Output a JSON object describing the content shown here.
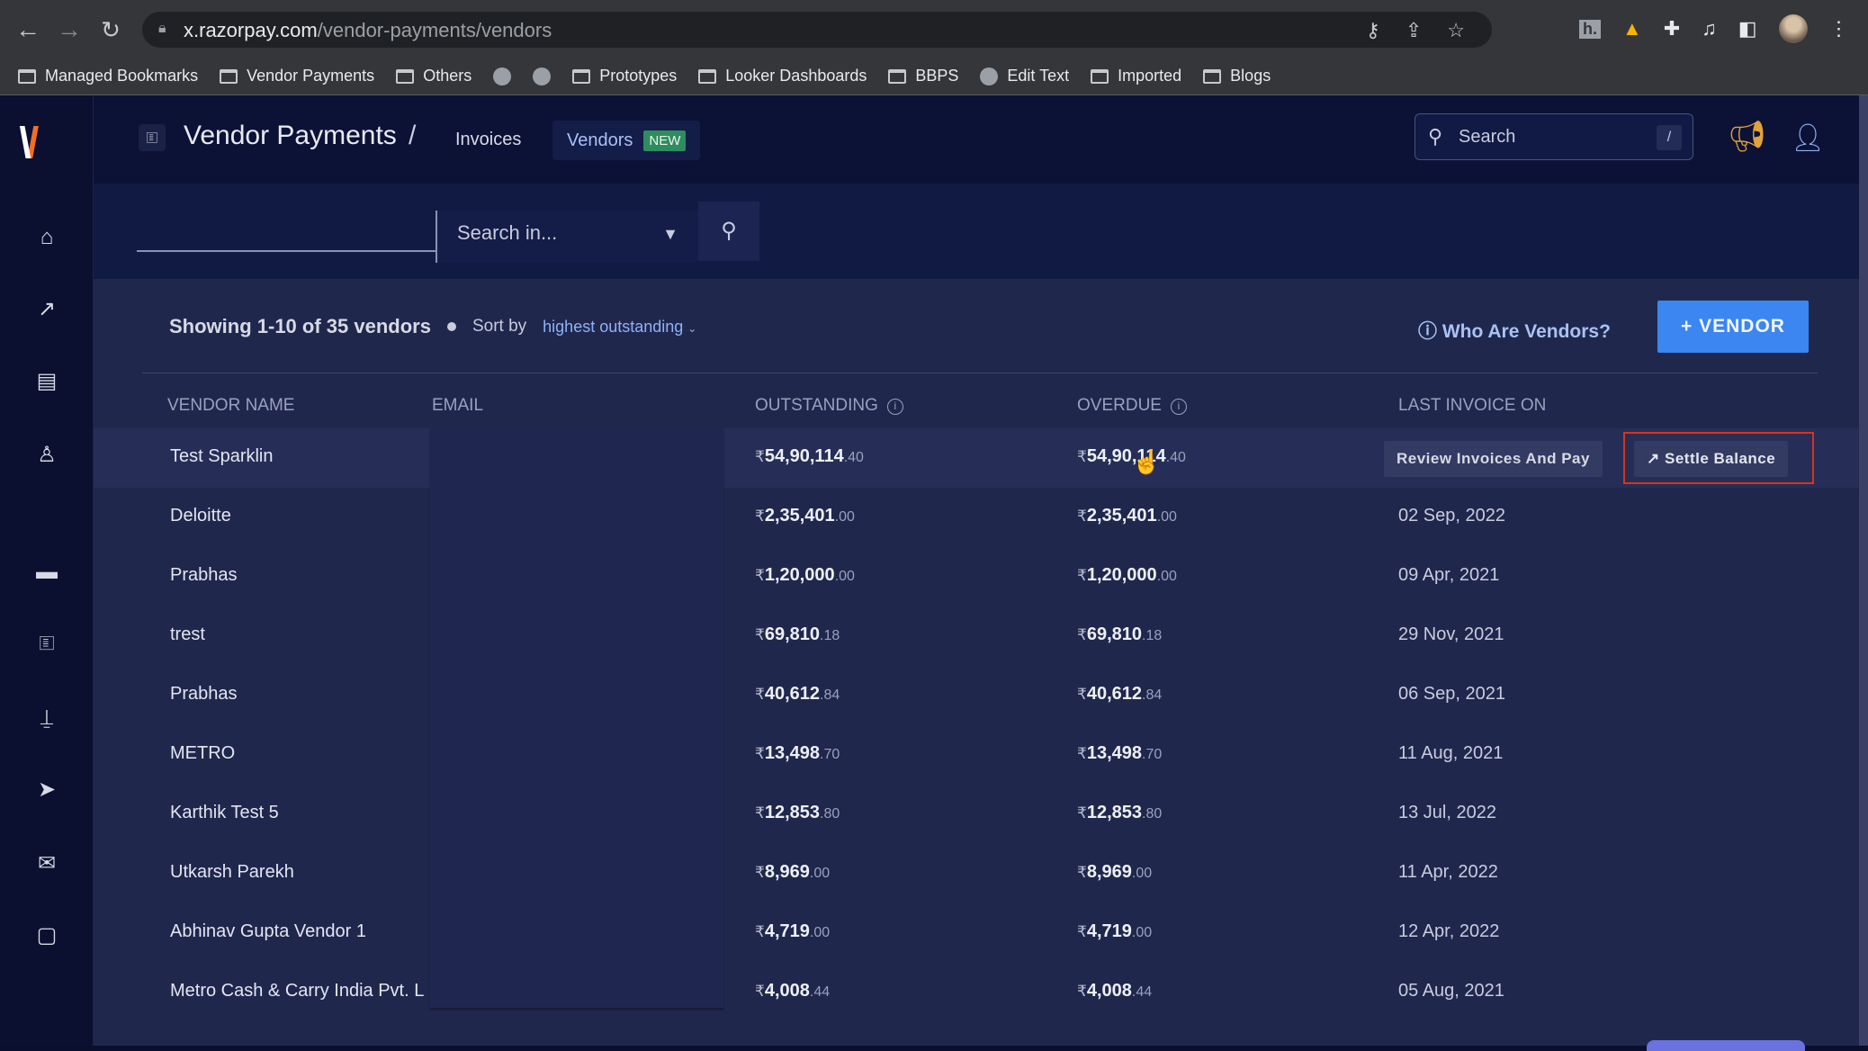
{
  "browser": {
    "url_host": "x.razorpay.com",
    "url_path": "/vendor-payments/vendors",
    "bookmarks": [
      {
        "label": "Managed Bookmarks",
        "type": "folder"
      },
      {
        "label": "Vendor Payments",
        "type": "folder"
      },
      {
        "label": "Others",
        "type": "folder"
      },
      {
        "label": "",
        "type": "globe"
      },
      {
        "label": "",
        "type": "globe"
      },
      {
        "label": "Prototypes",
        "type": "folder"
      },
      {
        "label": "Looker Dashboards",
        "type": "folder"
      },
      {
        "label": "BBPS",
        "type": "folder"
      },
      {
        "label": "Edit Text",
        "type": "globe"
      },
      {
        "label": "Imported",
        "type": "folder"
      },
      {
        "label": "Blogs",
        "type": "folder"
      }
    ]
  },
  "sidebar": {
    "logo": "X",
    "items": [
      {
        "icon": "home-icon",
        "glyph": "⌂"
      },
      {
        "icon": "arrow-up-right-icon",
        "glyph": "↗"
      },
      {
        "icon": "document-icon",
        "glyph": "▤"
      },
      {
        "icon": "user-icon",
        "glyph": "♙"
      },
      {
        "icon": "card-icon",
        "glyph": "▬"
      },
      {
        "icon": "invoice-icon",
        "glyph": "🗉"
      },
      {
        "icon": "stamp-icon",
        "glyph": "⍊"
      },
      {
        "icon": "send-icon",
        "glyph": "➤"
      },
      {
        "icon": "inbox-icon",
        "glyph": "✉"
      },
      {
        "icon": "note-icon",
        "glyph": "▢"
      }
    ]
  },
  "header": {
    "title": "Vendor Payments",
    "separator": "/",
    "tabs": [
      {
        "label": "Invoices",
        "active": false
      },
      {
        "label": "Vendors",
        "active": true,
        "badge": "NEW"
      }
    ],
    "search_placeholder": "Search",
    "search_shortcut": "/"
  },
  "filter": {
    "input_value": "",
    "select_placeholder": "Search in..."
  },
  "summary": {
    "showing": "Showing 1-10 of 35 vendors",
    "sort_label": "Sort by",
    "sort_value": "highest outstanding",
    "help_link": "Who Are Vendors?",
    "add_button": "+ VENDOR"
  },
  "table": {
    "columns": [
      "VENDOR NAME",
      "EMAIL",
      "OUTSTANDING",
      "OVERDUE",
      "LAST INVOICE ON"
    ],
    "currency": "₹",
    "row_actions": {
      "review": "Review Invoices And Pay",
      "settle": "Settle Balance"
    },
    "rows": [
      {
        "name": "Test Sparklin",
        "email": "",
        "outstanding_int": "54,90,114",
        "outstanding_dec": ".40",
        "overdue_int": "54,90,114",
        "overdue_dec": ".40",
        "last_invoice": ""
      },
      {
        "name": "Deloitte",
        "email": "",
        "outstanding_int": "2,35,401",
        "outstanding_dec": ".00",
        "overdue_int": "2,35,401",
        "overdue_dec": ".00",
        "last_invoice": "02 Sep, 2022"
      },
      {
        "name": "Prabhas",
        "email": "",
        "outstanding_int": "1,20,000",
        "outstanding_dec": ".00",
        "overdue_int": "1,20,000",
        "overdue_dec": ".00",
        "last_invoice": "09 Apr, 2021"
      },
      {
        "name": "trest",
        "email": "",
        "outstanding_int": "69,810",
        "outstanding_dec": ".18",
        "overdue_int": "69,810",
        "overdue_dec": ".18",
        "last_invoice": "29 Nov, 2021"
      },
      {
        "name": "Prabhas",
        "email": "",
        "outstanding_int": "40,612",
        "outstanding_dec": ".84",
        "overdue_int": "40,612",
        "overdue_dec": ".84",
        "last_invoice": "06 Sep, 2021"
      },
      {
        "name": "METRO",
        "email": "",
        "outstanding_int": "13,498",
        "outstanding_dec": ".70",
        "overdue_int": "13,498",
        "overdue_dec": ".70",
        "last_invoice": "11 Aug, 2021"
      },
      {
        "name": "Karthik Test 5",
        "email": "",
        "outstanding_int": "12,853",
        "outstanding_dec": ".80",
        "overdue_int": "12,853",
        "overdue_dec": ".80",
        "last_invoice": "13 Jul, 2022"
      },
      {
        "name": "Utkarsh Parekh",
        "email": "",
        "outstanding_int": "8,969",
        "outstanding_dec": ".00",
        "overdue_int": "8,969",
        "overdue_dec": ".00",
        "last_invoice": "11 Apr, 2022"
      },
      {
        "name": "Abhinav Gupta Vendor 1",
        "email": "",
        "outstanding_int": "4,719",
        "outstanding_dec": ".00",
        "overdue_int": "4,719",
        "overdue_dec": ".00",
        "last_invoice": "12 Apr, 2022"
      },
      {
        "name": "Metro Cash & Carry India Pvt. L",
        "email": "",
        "outstanding_int": "4,008",
        "outstanding_dec": ".44",
        "overdue_int": "4,008",
        "overdue_dec": ".44",
        "last_invoice": "05 Aug, 2021"
      }
    ]
  },
  "colors": {
    "accent": "#3b86f0",
    "link": "#8fb2f7",
    "badge_new": "#2f8c5f",
    "highlight_border": "#d8331f",
    "announce": "#e3a23a"
  }
}
